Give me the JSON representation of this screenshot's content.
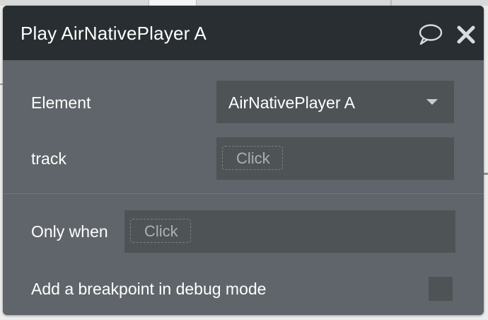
{
  "panel": {
    "title": "Play AirNativePlayer A",
    "header_icons": [
      "comment-icon",
      "close-icon"
    ]
  },
  "fields": {
    "element": {
      "label": "Element",
      "value": "AirNativePlayer A",
      "icon": "chevron-down-icon"
    },
    "track": {
      "label": "track",
      "placeholder": "Click"
    }
  },
  "condition": {
    "label": "Only when",
    "placeholder": "Click"
  },
  "debug": {
    "label": "Add a breakpoint in debug mode",
    "checked": false
  },
  "colors": {
    "header_bg": "#282e31",
    "panel_bg": "#5f656a",
    "field_bg": "#4e5356",
    "text": "#ffffff",
    "placeholder": "#aab0b4"
  }
}
